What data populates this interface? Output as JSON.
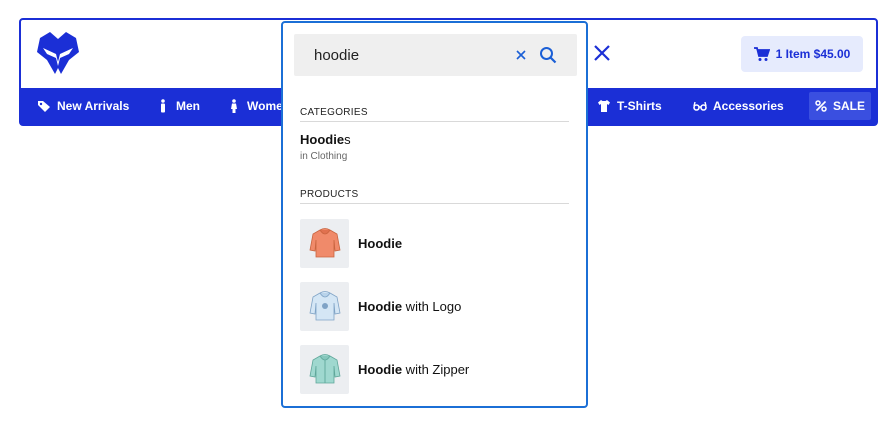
{
  "header": {
    "cart_label": "1 Item $45.00"
  },
  "nav": {
    "items": [
      {
        "label": "New Arrivals",
        "icon": "tag-icon"
      },
      {
        "label": "Men",
        "icon": "man-icon"
      },
      {
        "label": "Women",
        "icon": "woman-icon"
      },
      {
        "label": "T-Shirts",
        "icon": "tshirt-icon"
      },
      {
        "label": "Accessories",
        "icon": "glasses-icon"
      }
    ],
    "sale_label": "SALE"
  },
  "search": {
    "value": "hoodie",
    "categories_title": "CATEGORIES",
    "products_title": "PRODUCTS",
    "category": {
      "match": "Hoodie",
      "rest": "s",
      "sub": "in Clothing"
    },
    "products": [
      {
        "match": "Hoodie",
        "rest": ""
      },
      {
        "match": "Hoodie",
        "rest": " with Logo"
      },
      {
        "match": "Hoodie",
        "rest": " with Zipper"
      }
    ]
  },
  "colors": {
    "brand_blue": "#1b2fd6",
    "cart_bg": "#e6ebfd",
    "hoodie_1": "#f08a6a",
    "hoodie_2": "#b9d3ea",
    "hoodie_3": "#9fd8cf"
  }
}
